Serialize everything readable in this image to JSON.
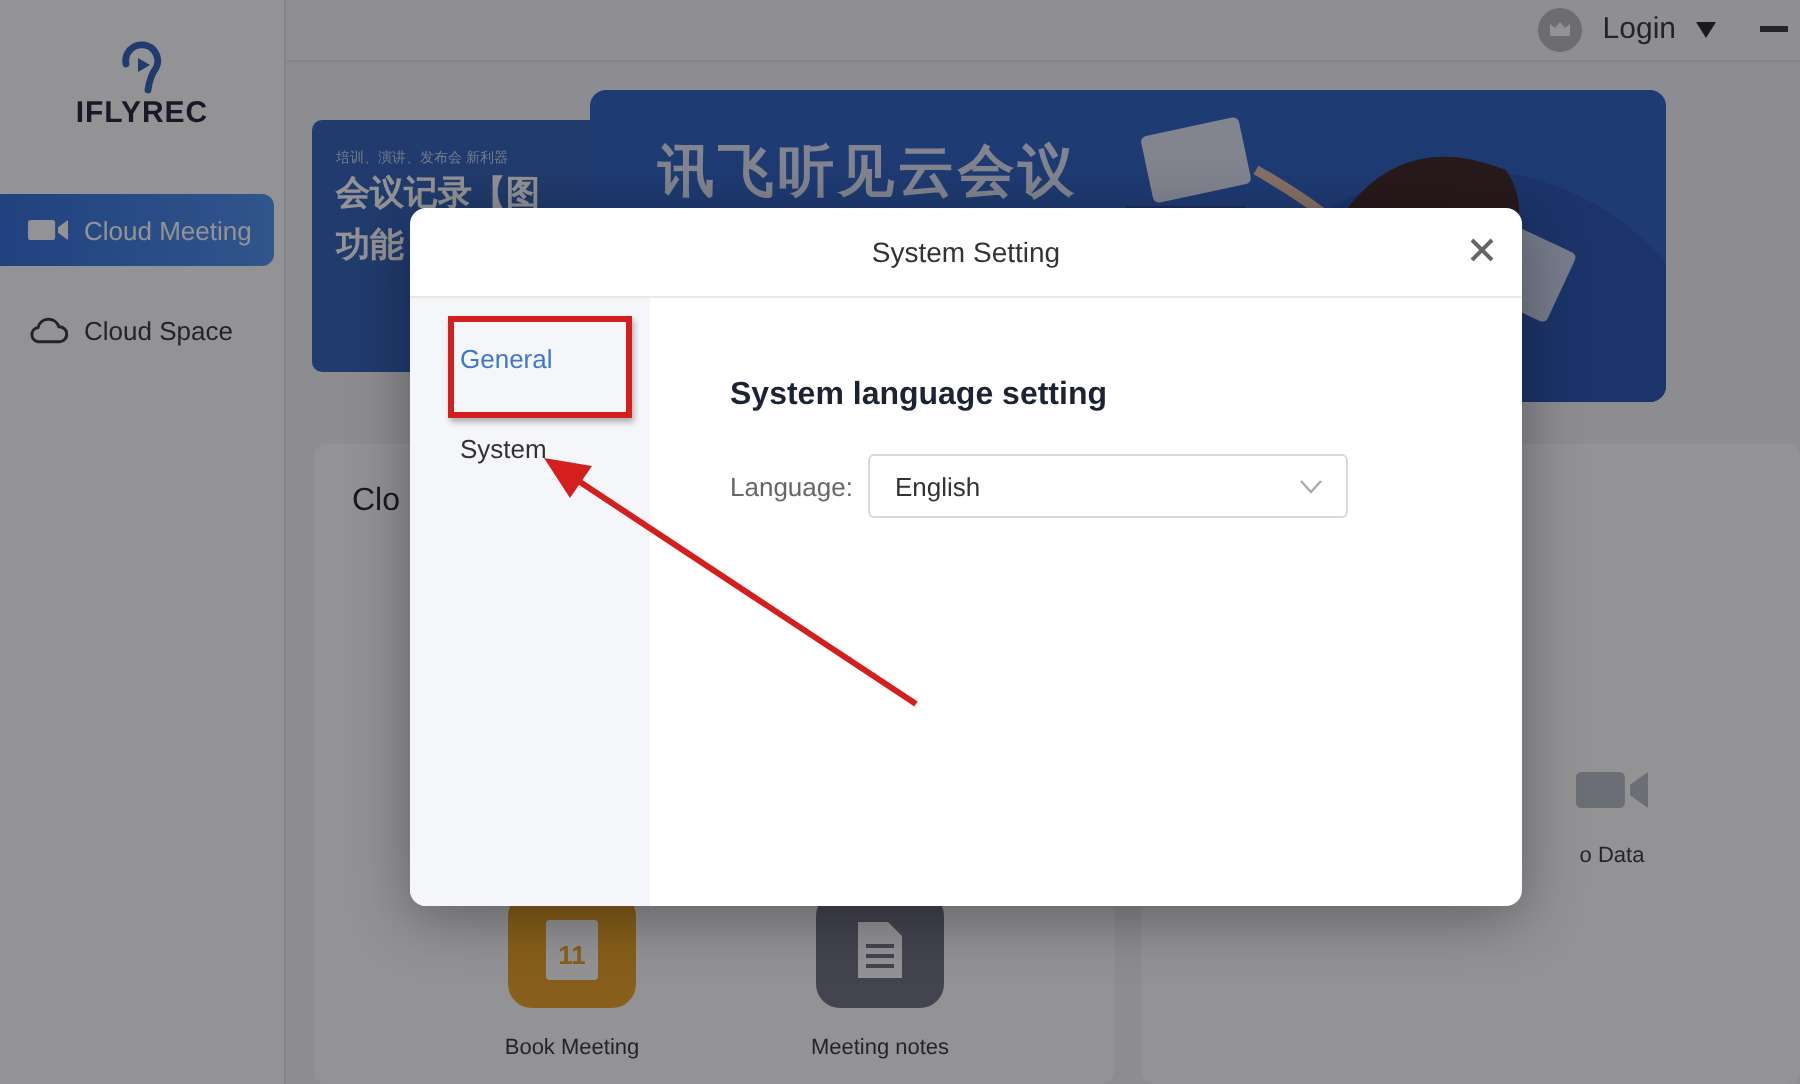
{
  "app": {
    "logo": "IFLYREC"
  },
  "sidebar": {
    "items": [
      {
        "label": "Cloud Meeting",
        "kind": "video",
        "selected": true
      },
      {
        "label": "Cloud Space",
        "kind": "cloud",
        "selected": false
      }
    ]
  },
  "header": {
    "login": "Login"
  },
  "banners": {
    "small": {
      "tagline": "培训、演讲、发布会 新利器",
      "title_lines": [
        "会议记录【图",
        "功能"
      ]
    },
    "main": {
      "title": "讯飞听见云会议"
    }
  },
  "cards": [
    {
      "title": "Clo",
      "actions": [
        {
          "label": "Book Meeting",
          "kind": "calendar",
          "day": "11"
        },
        {
          "label": "Meeting notes",
          "kind": "notes"
        }
      ]
    },
    {
      "actions": [
        {
          "label": "o Data",
          "kind": "video"
        }
      ]
    }
  ],
  "dialog": {
    "title": "System Setting",
    "tabs": [
      {
        "label": "General",
        "selected": true
      },
      {
        "label": "System",
        "selected": false
      }
    ],
    "section_title": "System language setting",
    "fields": [
      {
        "label": "Language:",
        "value": "English"
      }
    ]
  }
}
